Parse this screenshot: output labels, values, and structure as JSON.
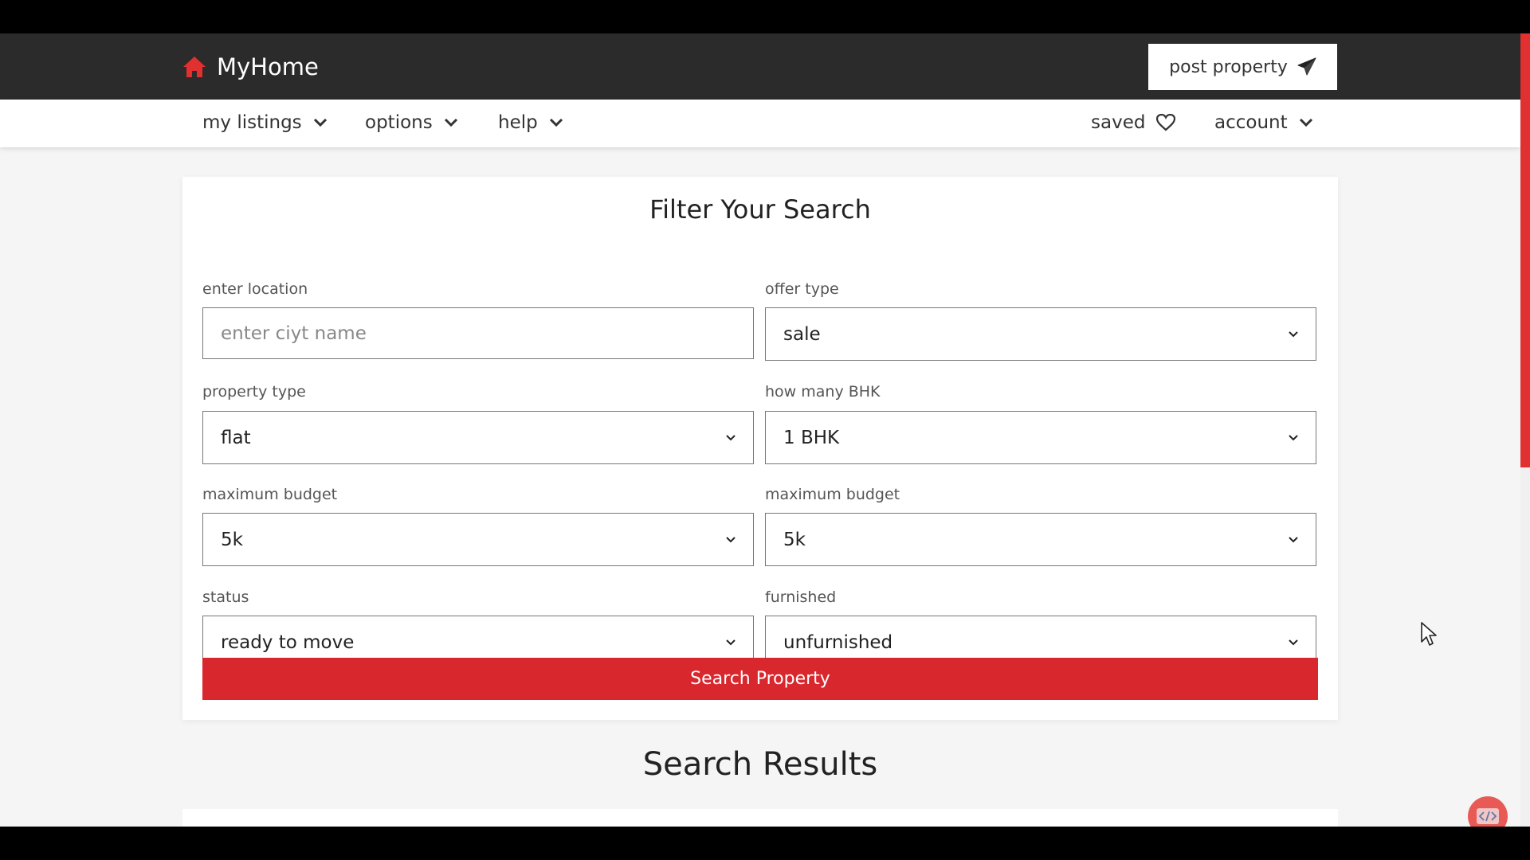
{
  "header": {
    "brand": "MyHome",
    "post_property_label": "post property"
  },
  "nav": {
    "my_listings": "my listings",
    "options": "options",
    "help": "help",
    "saved": "saved",
    "account": "account"
  },
  "filter": {
    "title": "Filter Your Search",
    "location_label": "enter location",
    "location_placeholder": "enter ciyt name",
    "offer_type_label": "offer type",
    "offer_type_value": "sale",
    "property_type_label": "property type",
    "property_type_value": "flat",
    "bhk_label": "how many BHK",
    "bhk_value": "1 BHK",
    "min_budget_label": "maximum budget",
    "min_budget_value": "5k",
    "max_budget_label": "maximum budget",
    "max_budget_value": "5k",
    "status_label": "status",
    "status_value": "ready to move",
    "furnished_label": "furnished",
    "furnished_value": "unfurnished",
    "search_button": "Search Property"
  },
  "results": {
    "title": "Search Results"
  },
  "colors": {
    "accent": "#d9272e",
    "header_bg": "#2b2b2b"
  },
  "icons": {
    "brand": "house-icon",
    "post": "paper-plane-icon",
    "saved": "heart-icon",
    "dropdown": "chevron-down-icon",
    "fab": "code-icon"
  }
}
